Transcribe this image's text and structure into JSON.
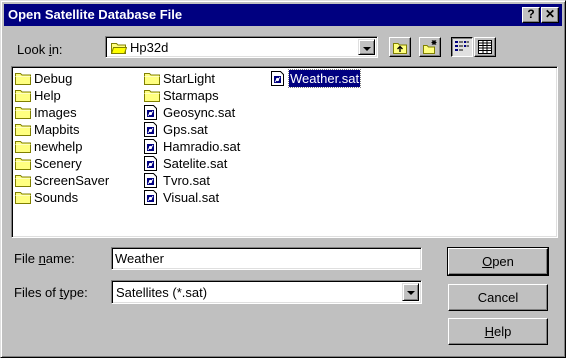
{
  "window": {
    "title": "Open Satellite Database File",
    "help_button": "?",
    "close_button": "✕"
  },
  "look_in": {
    "label_pre": "Look ",
    "label_key": "i",
    "label_post": "n:",
    "value": "Hp32d"
  },
  "files": {
    "column1": [
      {
        "name": "Debug",
        "type": "folder"
      },
      {
        "name": "Help",
        "type": "folder"
      },
      {
        "name": "Images",
        "type": "folder"
      },
      {
        "name": "Mapbits",
        "type": "folder"
      },
      {
        "name": "newhelp",
        "type": "folder"
      },
      {
        "name": "Scenery",
        "type": "folder"
      },
      {
        "name": "ScreenSaver",
        "type": "folder"
      },
      {
        "name": "Sounds",
        "type": "folder"
      }
    ],
    "column2": [
      {
        "name": "StarLight",
        "type": "folder"
      },
      {
        "name": "Starmaps",
        "type": "folder"
      },
      {
        "name": "Geosync.sat",
        "type": "file"
      },
      {
        "name": "Gps.sat",
        "type": "file"
      },
      {
        "name": "Hamradio.sat",
        "type": "file"
      },
      {
        "name": "Satelite.sat",
        "type": "file"
      },
      {
        "name": "Tvro.sat",
        "type": "file"
      },
      {
        "name": "Visual.sat",
        "type": "file"
      }
    ],
    "column3": [
      {
        "name": "Weather.sat",
        "type": "file",
        "selected": true
      }
    ]
  },
  "file_name": {
    "label_pre": "File ",
    "label_key": "n",
    "label_post": "ame:",
    "value": "Weather"
  },
  "file_type": {
    "label_pre": "Files of ",
    "label_key": "t",
    "label_post": "ype:",
    "value": "Satellites (*.sat)"
  },
  "buttons": {
    "open_key": "O",
    "open_rest": "pen",
    "cancel": "Cancel",
    "help_key": "H",
    "help_rest": "elp"
  },
  "colors": {
    "title_bar": "#000080",
    "face": "#c0c0c0",
    "folder": "#ffff80",
    "selection": "#000080"
  }
}
